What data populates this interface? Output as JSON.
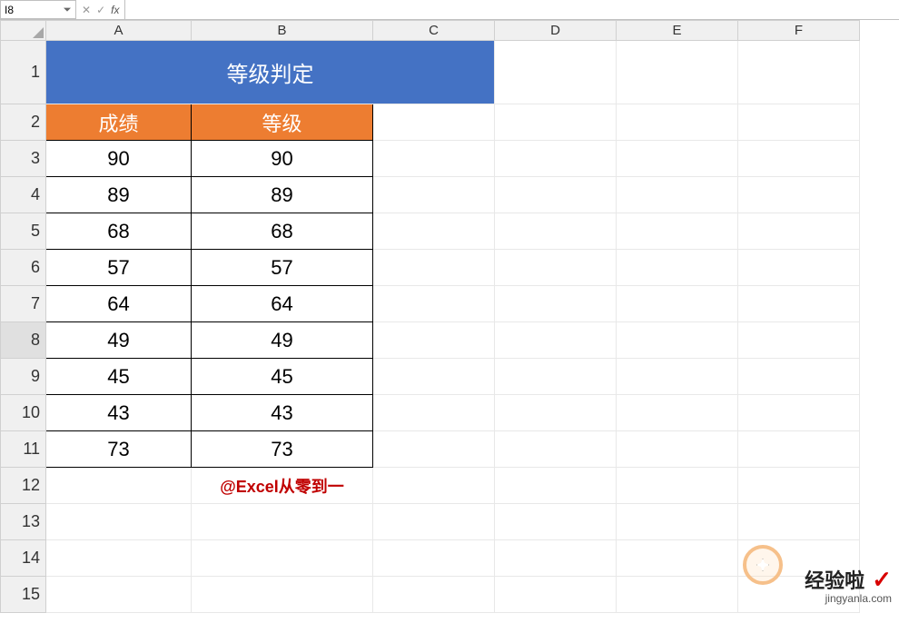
{
  "namebox": "I8",
  "formula": "",
  "col_headers": [
    "A",
    "B",
    "C",
    "D",
    "E",
    "F"
  ],
  "row_headers": [
    "1",
    "2",
    "3",
    "4",
    "5",
    "6",
    "7",
    "8",
    "9",
    "10",
    "11",
    "12",
    "13",
    "14",
    "15"
  ],
  "title": "等级判定",
  "table_headers": {
    "a": "成绩",
    "b": "等级"
  },
  "rows": [
    {
      "a": "90",
      "b": "90"
    },
    {
      "a": "89",
      "b": "89"
    },
    {
      "a": "68",
      "b": "68"
    },
    {
      "a": "57",
      "b": "57"
    },
    {
      "a": "64",
      "b": "64"
    },
    {
      "a": "49",
      "b": "49"
    },
    {
      "a": "45",
      "b": "45"
    },
    {
      "a": "43",
      "b": "43"
    },
    {
      "a": "73",
      "b": "73"
    }
  ],
  "footer": "@Excel从零到一",
  "watermark": {
    "main": "经验啦",
    "check": "✓",
    "sub": "jingyanla.com"
  },
  "selected_row": "8"
}
